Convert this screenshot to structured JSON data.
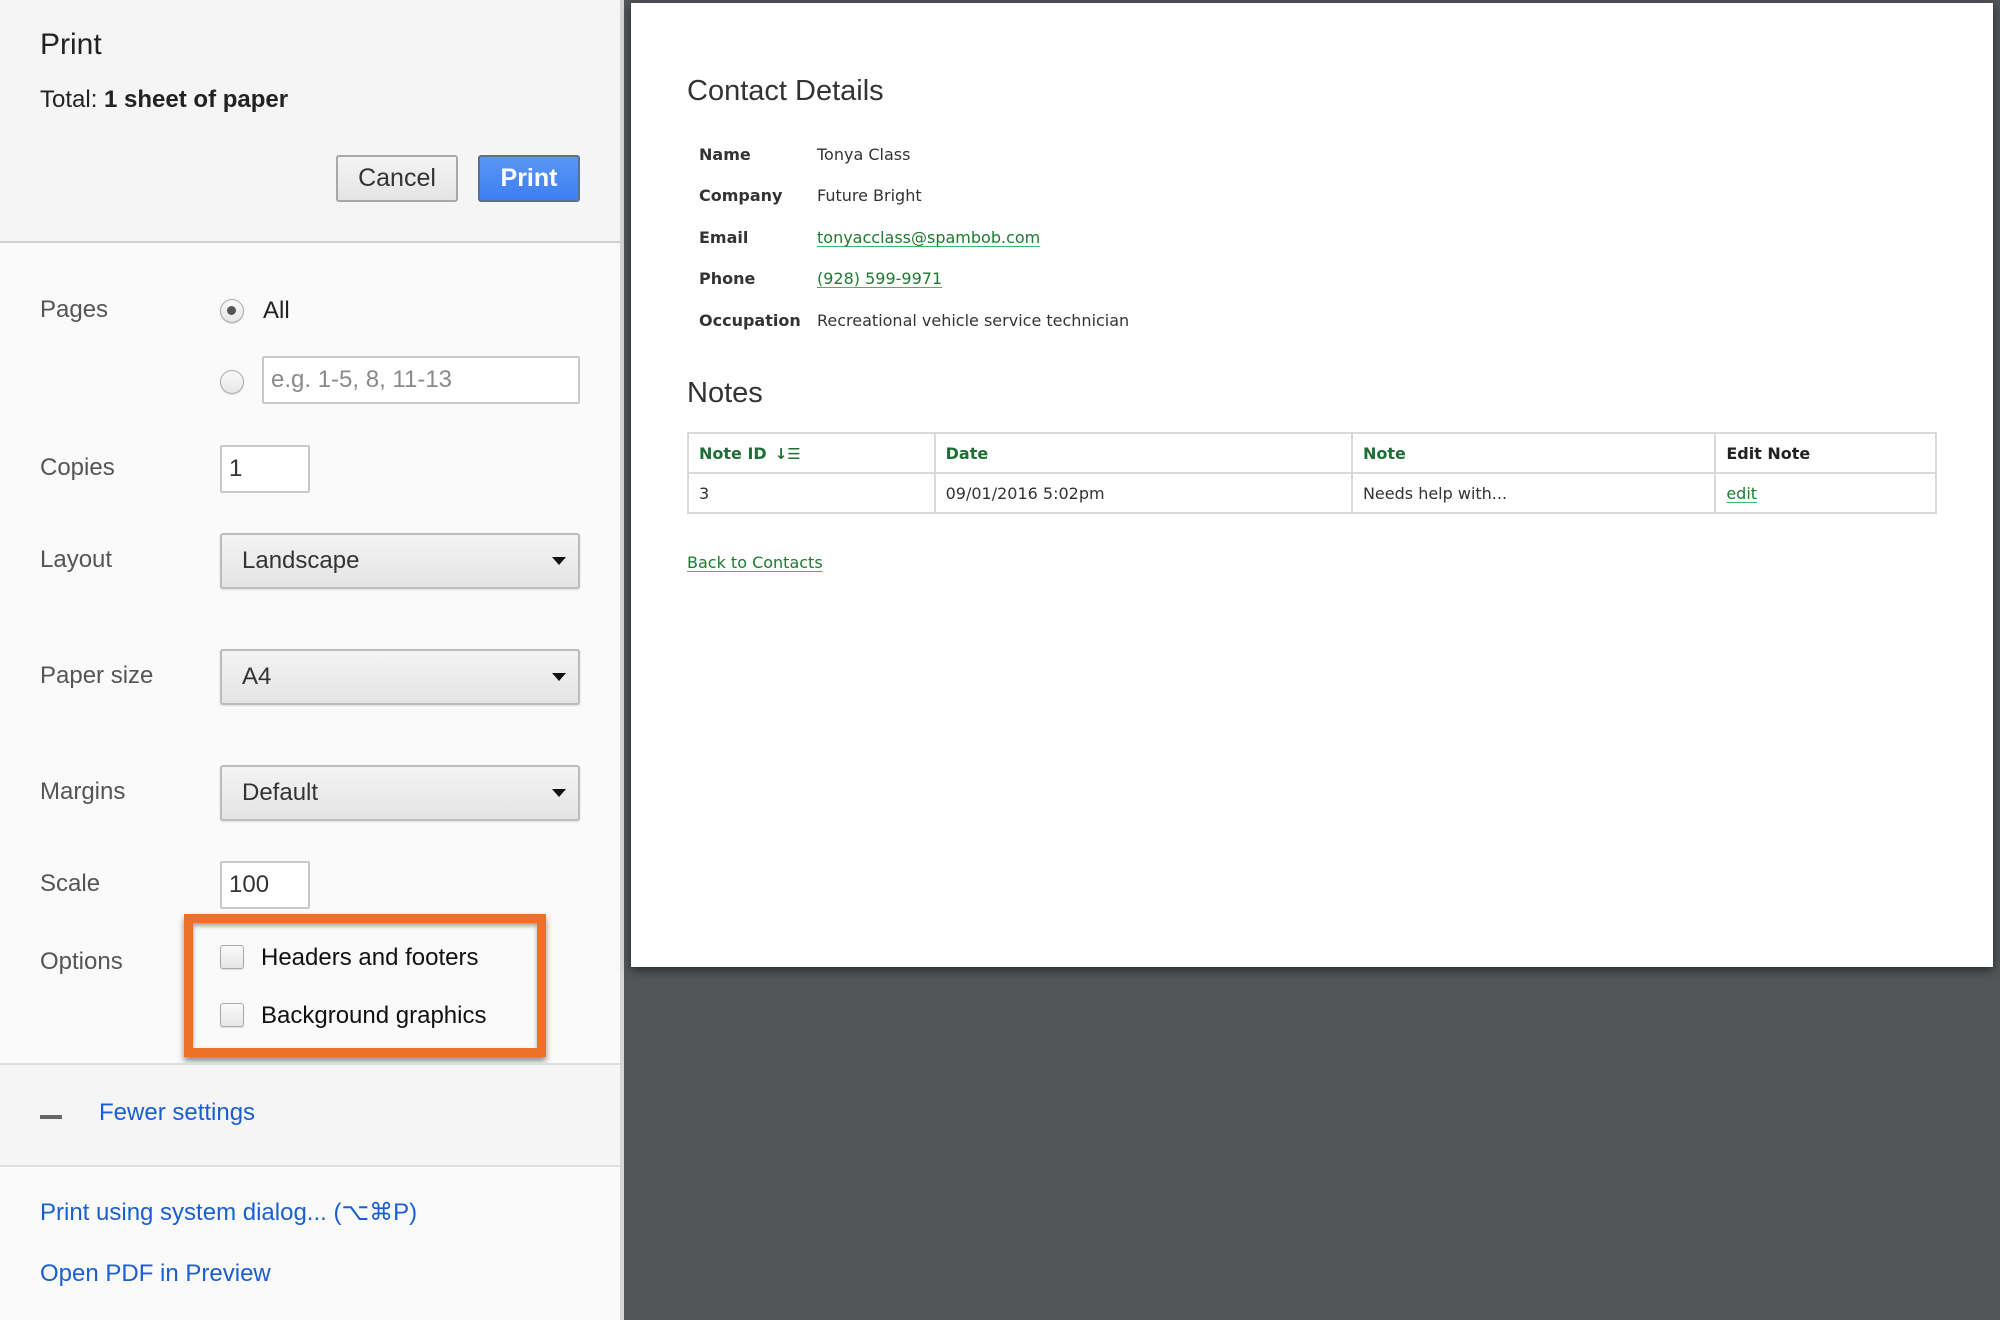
{
  "dialog": {
    "title": "Print",
    "total_prefix": "Total: ",
    "total_value": "1 sheet of paper",
    "cancel_label": "Cancel",
    "print_label": "Print"
  },
  "settings": {
    "pages": {
      "label": "Pages",
      "all_label": "All",
      "selected": "all",
      "range_placeholder": "e.g. 1-5, 8, 11-13",
      "range_value": ""
    },
    "copies": {
      "label": "Copies",
      "value": "1"
    },
    "layout": {
      "label": "Layout",
      "value": "Landscape"
    },
    "paper_size": {
      "label": "Paper size",
      "value": "A4"
    },
    "margins": {
      "label": "Margins",
      "value": "Default"
    },
    "scale": {
      "label": "Scale",
      "value": "100"
    },
    "options": {
      "label": "Options",
      "items": [
        {
          "label": "Headers and footers",
          "checked": false
        },
        {
          "label": "Background graphics",
          "checked": false
        }
      ],
      "highlight_color": "#ee7024"
    },
    "fewer_settings_label": "Fewer settings",
    "system_dialog_label": "Print using system dialog... (⌥⌘P)",
    "open_pdf_label": "Open PDF in Preview"
  },
  "preview": {
    "contact_heading": "Contact Details",
    "details": [
      {
        "key": "Name",
        "value": "Tonya Class",
        "link": false
      },
      {
        "key": "Company",
        "value": "Future Bright",
        "link": false
      },
      {
        "key": "Email",
        "value": "tonyacclass@spambob.com",
        "link": true
      },
      {
        "key": "Phone",
        "value": "(928) 599-9971",
        "link": true
      },
      {
        "key": "Occupation",
        "value": "Recreational vehicle service technician",
        "link": false
      }
    ],
    "notes_heading": "Notes",
    "table": {
      "headers": [
        "Note ID",
        "Date",
        "Note",
        "Edit Note"
      ],
      "sort_icon": "sort-ascending-icon",
      "rows": [
        [
          "3",
          "09/01/2016 5:02pm",
          "Needs help with...",
          "edit"
        ]
      ]
    },
    "back_link": "Back to Contacts",
    "link_color": "#1e7a2f",
    "header_color": "#1f6e36"
  },
  "colors": {
    "primary_button": "#4285f4",
    "link_blue": "#1a5fd0",
    "preview_background": "#525659"
  }
}
